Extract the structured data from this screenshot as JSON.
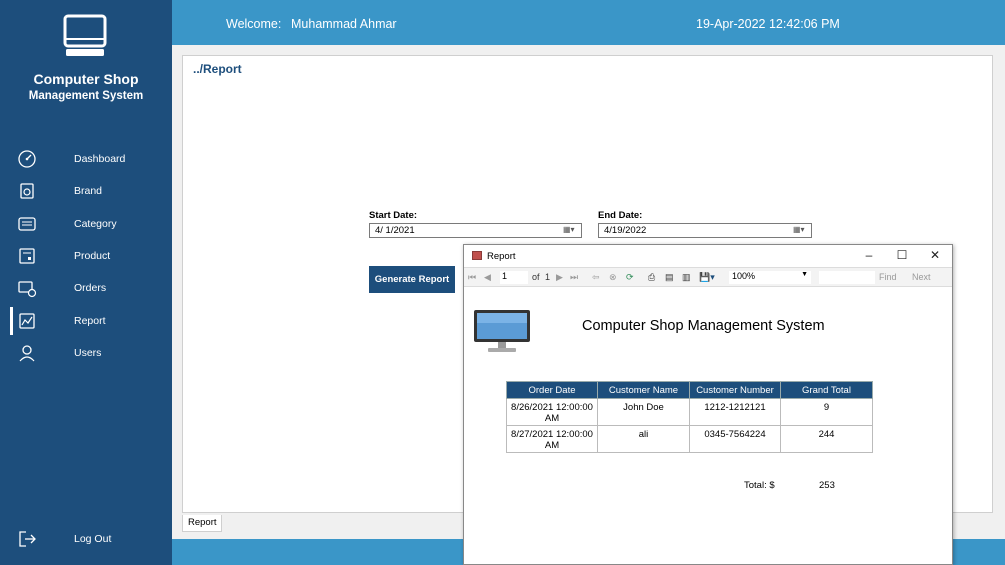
{
  "app": {
    "title": "Computer Shop",
    "subtitle": "Management System"
  },
  "sidebar": {
    "items": [
      {
        "label": "Dashboard",
        "icon": "speedometer-icon"
      },
      {
        "label": "Brand",
        "icon": "brand-tag-icon"
      },
      {
        "label": "Category",
        "icon": "category-list-icon"
      },
      {
        "label": "Product",
        "icon": "product-box-icon"
      },
      {
        "label": "Orders",
        "icon": "orders-icon"
      },
      {
        "label": "Report",
        "icon": "chart-icon",
        "active": true
      },
      {
        "label": "Users",
        "icon": "user-icon"
      }
    ],
    "logout_label": "Log Out"
  },
  "header": {
    "welcome_label": "Welcome:",
    "user_name": "Muhammad Ahmar",
    "datetime": "19-Apr-2022 12:42:06 PM"
  },
  "main": {
    "breadcrumb": "../Report",
    "start_date_label": "Start Date:",
    "start_date_value": "4/  1/2021",
    "end_date_label": "End Date:",
    "end_date_value": "4/19/2022",
    "generate_button": "Generate Report",
    "bottom_tab": "Report"
  },
  "report_window": {
    "title": "Report",
    "toolbar": {
      "page_value": "1",
      "of_label": "of",
      "page_count": "1",
      "zoom": "100%",
      "find_label": "Find",
      "next_label": "Next"
    },
    "heading": "Computer Shop Management System",
    "table": {
      "headers": [
        "Order Date",
        "Customer Name",
        "Customer Number",
        "Grand Total"
      ],
      "rows": [
        [
          "8/26/2021 12:00:00 AM",
          "John Doe",
          "1212-1212121",
          "9"
        ],
        [
          "8/27/2021 12:00:00 AM",
          "ali",
          "0345-7564224",
          "244"
        ]
      ]
    },
    "total_label": "Total: $",
    "total_value": "253"
  },
  "colors": {
    "sidebar": "#1d4e7c",
    "topbar": "#3a96c8",
    "accent": "#1d4e7c"
  }
}
